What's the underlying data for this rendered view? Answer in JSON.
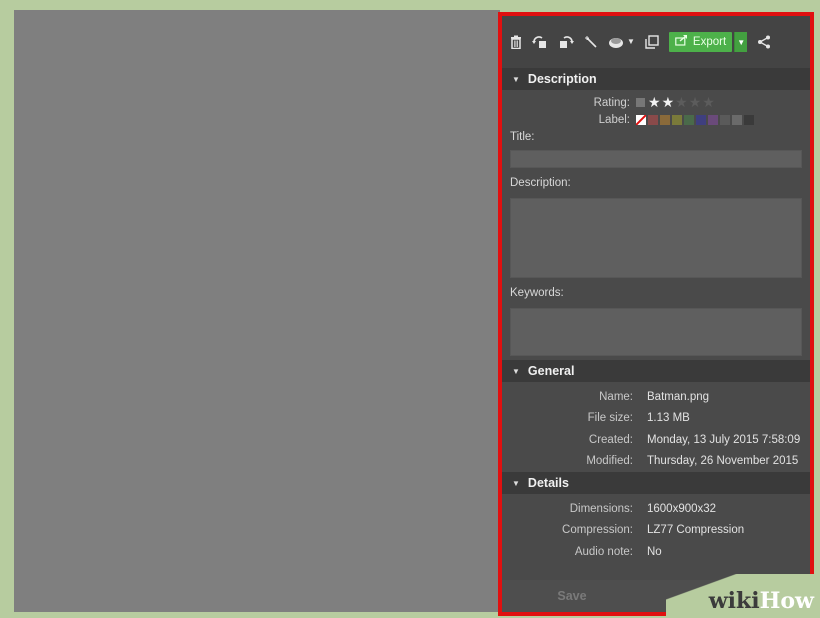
{
  "toolbar": {
    "icons": [
      "trash-icon",
      "rotate-left-icon",
      "rotate-right-icon",
      "magic-wand-icon",
      "eraser-icon",
      "dropdown-icon",
      "copy-icon",
      "share-icon"
    ],
    "export_label": "Export"
  },
  "description": {
    "heading": "Description",
    "rating_label": "Rating:",
    "rating_value": 2,
    "rating_max": 5,
    "label_label": "Label:",
    "label_colors": [
      "#8a4a4a",
      "#8a6a3a",
      "#7a7a3a",
      "#4a6a4a",
      "#3f3f7f",
      "#6a4a7a",
      "#5a5a5a",
      "#6a6a6a",
      "#3a3a3a"
    ],
    "title_label": "Title:",
    "title_value": "",
    "description_label": "Description:",
    "description_value": "",
    "keywords_label": "Keywords:",
    "keywords_value": ""
  },
  "general": {
    "heading": "General",
    "rows": [
      {
        "key": "Name:",
        "value": "Batman.png"
      },
      {
        "key": "File size:",
        "value": "1.13 MB"
      },
      {
        "key": "Created:",
        "value": "Monday, 13 July 2015 7:58:09"
      },
      {
        "key": "Modified:",
        "value": "Thursday, 26 November 2015"
      }
    ]
  },
  "details": {
    "heading": "Details",
    "rows": [
      {
        "key": "Dimensions:",
        "value": "1600x900x32"
      },
      {
        "key": "Compression:",
        "value": "LZ77 Compression"
      },
      {
        "key": "Audio note:",
        "value": "No"
      }
    ]
  },
  "footer": {
    "save_label": "Save"
  },
  "watermark": {
    "part1": "wiki",
    "part2": "How"
  },
  "colors": {
    "accent_red": "#e01010",
    "export_green": "#4db14a",
    "background_green": "#b7cc9f"
  }
}
